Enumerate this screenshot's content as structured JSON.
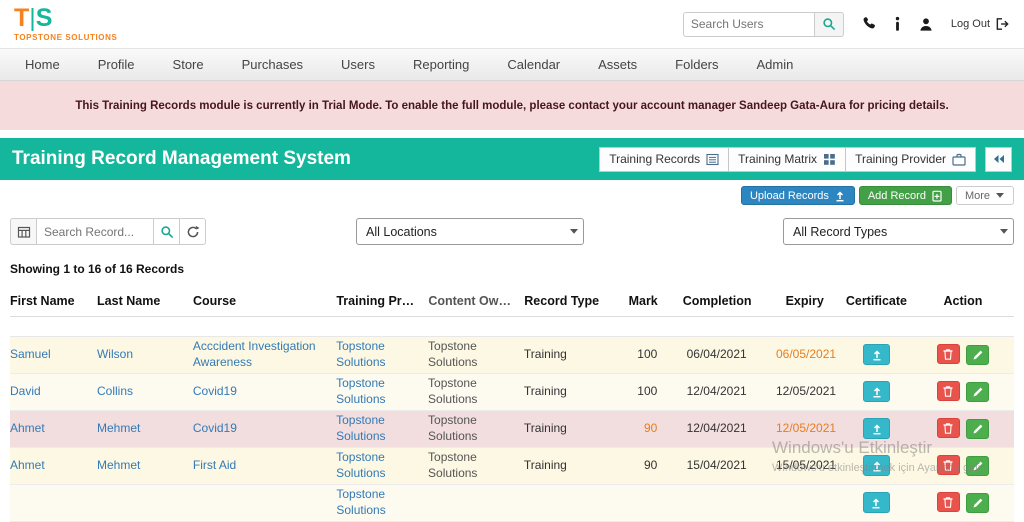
{
  "colors": {
    "accent_teal": "#14b79c",
    "brand_orange": "#f5821f",
    "link_blue": "#337ab7",
    "warn_orange": "#e67e22",
    "upload_blue": "#2e86c1",
    "add_green": "#43a047",
    "certificate_teal": "#35b8c9",
    "delete_red": "#e8544c",
    "edit_green": "#4cae4c",
    "alert_pink": "#f6dbdd"
  },
  "brand": {
    "logo_t": "T",
    "logo_sep": "|",
    "logo_s": "S",
    "logo_subtitle": "TOPSTONE SOLUTIONS"
  },
  "top": {
    "search_placeholder": "Search Users",
    "logout_label": "Log Out"
  },
  "nav": {
    "items": [
      "Home",
      "Profile",
      "Store",
      "Purchases",
      "Users",
      "Reporting",
      "Calendar",
      "Assets",
      "Folders",
      "Admin"
    ]
  },
  "alert": {
    "text": "This Training Records module is currently in Trial Mode. To enable the full module, please contact your account manager Sandeep Gata-Aura for pricing details."
  },
  "title_bar": {
    "title": "Training Record Management System",
    "buttons": [
      {
        "label": "Training Records",
        "icon": "list-icon"
      },
      {
        "label": "Training Matrix",
        "icon": "grid-icon"
      },
      {
        "label": "Training Provider",
        "icon": "briefcase-icon"
      }
    ]
  },
  "toolbar": {
    "upload_label": "Upload Records",
    "add_label": "Add Record",
    "more_label": "More"
  },
  "filters": {
    "search_placeholder": "Search Record...",
    "locations_value": "All Locations",
    "record_types_value": "All Record Types"
  },
  "summary_text": "Showing 1 to 16 of 16 Records",
  "table": {
    "headers": [
      "First Name",
      "Last Name",
      "Course",
      "Training Provid...",
      "Content Owner",
      "Record Type",
      "Mark",
      "Completion",
      "Expiry",
      "Certificate",
      "Action"
    ],
    "rows": [
      {
        "first_name": "Samuel",
        "last_name": "Wilson",
        "course": "Acccident Investigation Awareness",
        "training_provider": "Topstone Solutions",
        "content_owner": "Topstone Solutions",
        "record_type": "Training",
        "mark": "100",
        "completion": "06/04/2021",
        "expiry": "06/05/2021",
        "row_color": "cream",
        "mark_highlight": false,
        "expiry_highlight": true,
        "partial": false
      },
      {
        "first_name": "David",
        "last_name": "Collins",
        "course": "Covid19",
        "training_provider": "Topstone Solutions",
        "content_owner": "Topstone Solutions",
        "record_type": "Training",
        "mark": "100",
        "completion": "12/04/2021",
        "expiry": "12/05/2021",
        "row_color": "cream_light",
        "mark_highlight": false,
        "expiry_highlight": false,
        "partial": false
      },
      {
        "first_name": "Ahmet",
        "last_name": "Mehmet",
        "course": "Covid19",
        "training_provider": "Topstone Solutions",
        "content_owner": "Topstone Solutions",
        "record_type": "Training",
        "mark": "90",
        "completion": "12/04/2021",
        "expiry": "12/05/2021",
        "row_color": "pink",
        "mark_highlight": true,
        "expiry_highlight": true,
        "partial": false
      },
      {
        "first_name": "Ahmet",
        "last_name": "Mehmet",
        "course": "First Aid",
        "training_provider": "Topstone Solutions",
        "content_owner": "Topstone Solutions",
        "record_type": "Training",
        "mark": "90",
        "completion": "15/04/2021",
        "expiry": "15/05/2021",
        "row_color": "cream",
        "mark_highlight": false,
        "expiry_highlight": false,
        "partial": false
      },
      {
        "first_name": "",
        "last_name": "",
        "course": "",
        "training_provider": "Topstone Solutions",
        "content_owner": "",
        "record_type": "",
        "mark": "",
        "completion": "",
        "expiry": "",
        "row_color": "cream_light",
        "mark_highlight": false,
        "expiry_highlight": false,
        "partial": true
      }
    ]
  },
  "watermark": {
    "line1": "Windows'u Etkinleştir",
    "line2": "Windows'u etkinleştirmek için Ayarlar'a gidin."
  }
}
